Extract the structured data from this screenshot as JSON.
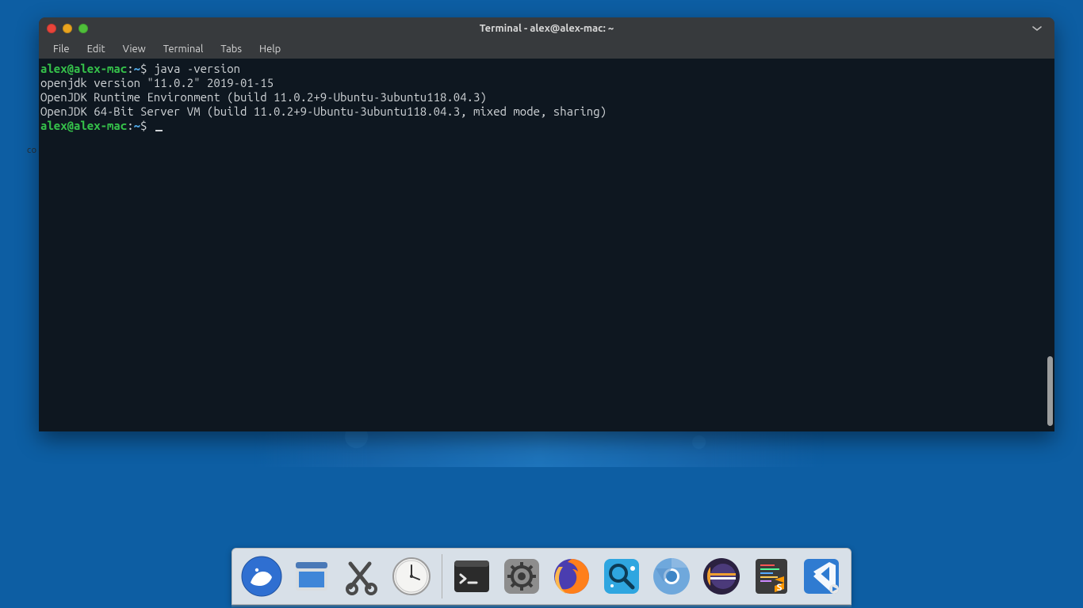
{
  "desktop": {
    "peek_text": "co"
  },
  "window": {
    "title": "Terminal - alex@alex-mac: ~",
    "menubar": [
      "File",
      "Edit",
      "View",
      "Terminal",
      "Tabs",
      "Help"
    ],
    "prompt": {
      "user_host": "alex@alex-mac",
      "sep1": ":",
      "path": "~",
      "sigil": "$ "
    },
    "commands": [
      {
        "input": "java -version",
        "output": [
          "openjdk version \"11.0.2\" 2019-01-15",
          "OpenJDK Runtime Environment (build 11.0.2+9-Ubuntu-3ubuntu118.04.3)",
          "OpenJDK 64-Bit Server VM (build 11.0.2+9-Ubuntu-3ubuntu118.04.3, mixed mode, sharing)"
        ]
      }
    ]
  },
  "dock": {
    "items": [
      {
        "name": "xubuntu-menu",
        "label": "Xubuntu Menu"
      },
      {
        "name": "file-manager",
        "label": "File Manager"
      },
      {
        "name": "scissors",
        "label": "Screenshot / Cut"
      },
      {
        "name": "clock",
        "label": "Clock"
      },
      {
        "name": "terminal",
        "label": "Terminal",
        "running": true
      },
      {
        "name": "settings",
        "label": "Settings"
      },
      {
        "name": "firefox",
        "label": "Firefox"
      },
      {
        "name": "browse",
        "label": "GNOME Web"
      },
      {
        "name": "chromium",
        "label": "Chromium"
      },
      {
        "name": "eclipse",
        "label": "Eclipse"
      },
      {
        "name": "sublime",
        "label": "Sublime Text"
      },
      {
        "name": "vscode",
        "label": "VS Code"
      }
    ]
  }
}
